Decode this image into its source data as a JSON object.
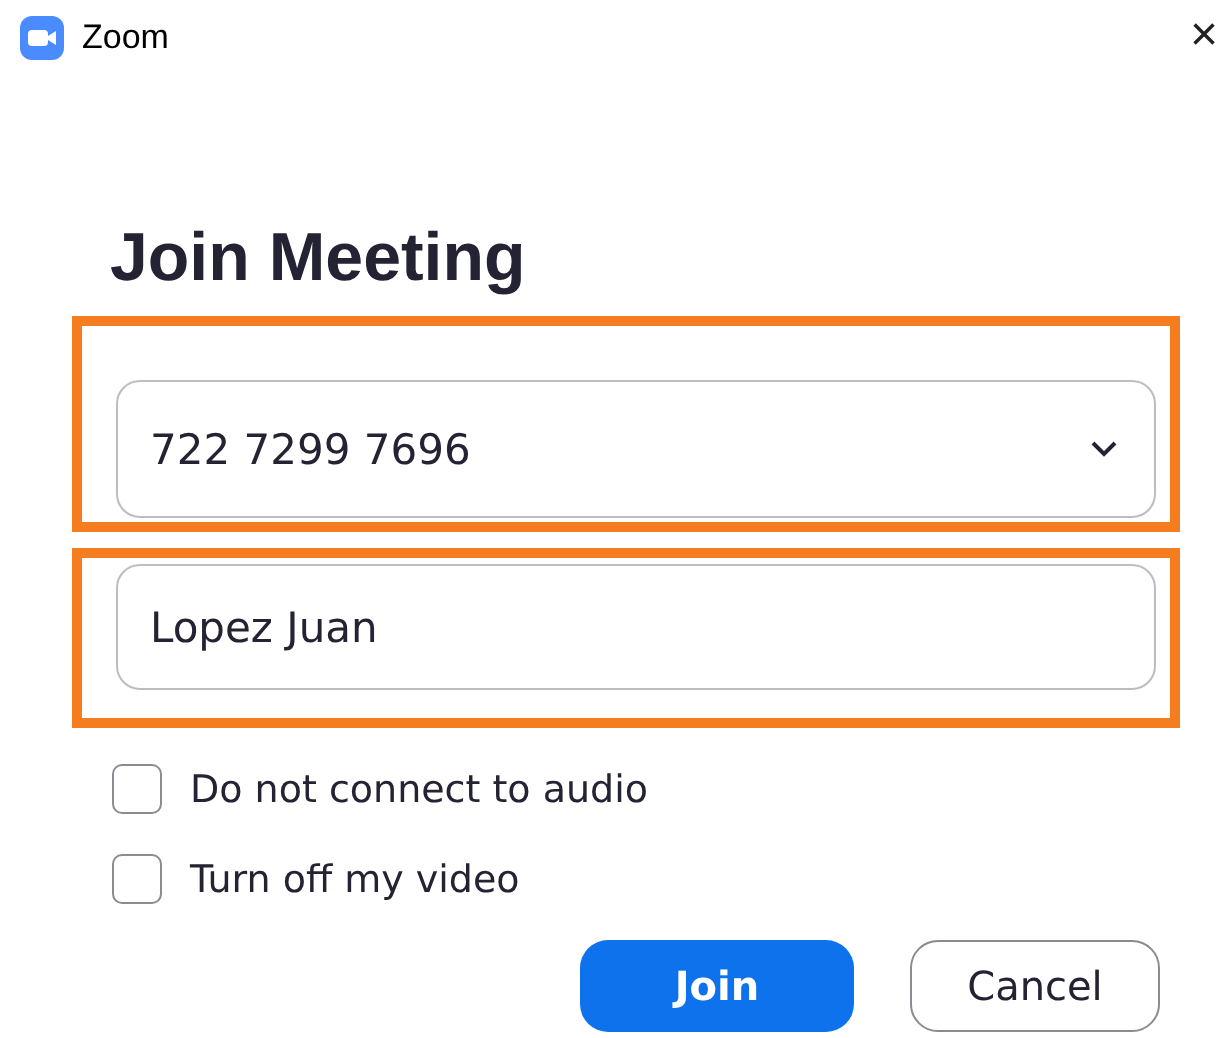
{
  "window": {
    "title": "Zoom",
    "close": "×"
  },
  "heading": "Join Meeting",
  "fields": [
    {
      "kind": "dropdown",
      "value": "722 7299 7696",
      "highlighted": true
    },
    {
      "kind": "text",
      "value": "Lopez Juan",
      "highlighted": true
    }
  ],
  "options": [
    {
      "label": "Do not connect to audio",
      "checked": false
    },
    {
      "label": "Turn off my video",
      "checked": false
    }
  ],
  "buttons": [
    {
      "label": "Join",
      "kind": "primary"
    },
    {
      "label": "Cancel",
      "kind": "secondary"
    }
  ]
}
